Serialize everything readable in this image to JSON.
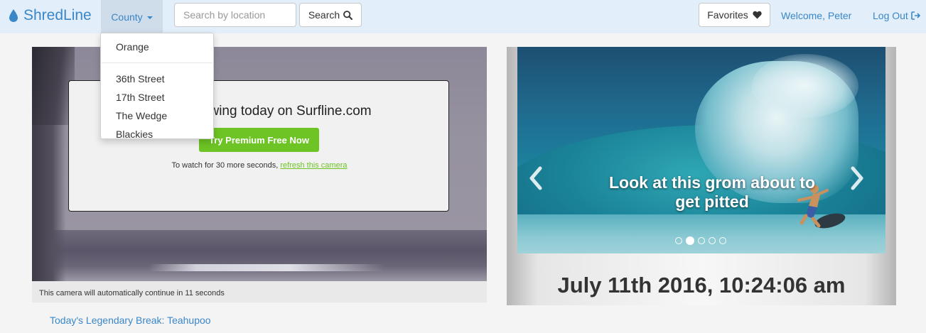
{
  "navbar": {
    "brand": "ShredLine",
    "county_label": "County",
    "search_placeholder": "Search by location",
    "search_label": "Search",
    "favorites_label": "Favorites",
    "welcome": "Welcome, Peter",
    "logout": "Log Out"
  },
  "dropdown": {
    "header": "Orange",
    "items": [
      "36th Street",
      "17th Street",
      "The Wedge",
      "Blackies"
    ]
  },
  "camera": {
    "promo_title": "Viewing today on Surfline.com",
    "promo_button": "Try Premium Free Now",
    "promo_note_prefix": "To watch for 30 more seconds, ",
    "promo_note_link": "refresh this camera",
    "footer": "This camera will automatically continue in 11 seconds"
  },
  "carousel": {
    "caption_line1": "Look at this grom about to",
    "caption_line2": "get pitted",
    "slide_count": 5,
    "active_index": 1
  },
  "clock": "July 11th 2016, 10:24:06 am",
  "legendary_break": "Today's Legendary Break: Teahupoo",
  "colors": {
    "navbar_bg": "#e2eefa",
    "link_blue": "#3a87c8",
    "promo_green": "#6dc424"
  },
  "icons": {
    "brand": "water-drop-icon",
    "search": "magnifier-icon",
    "favorites": "heart-icon",
    "logout": "sign-out-icon",
    "prev": "chevron-left-icon",
    "next": "chevron-right-icon"
  }
}
